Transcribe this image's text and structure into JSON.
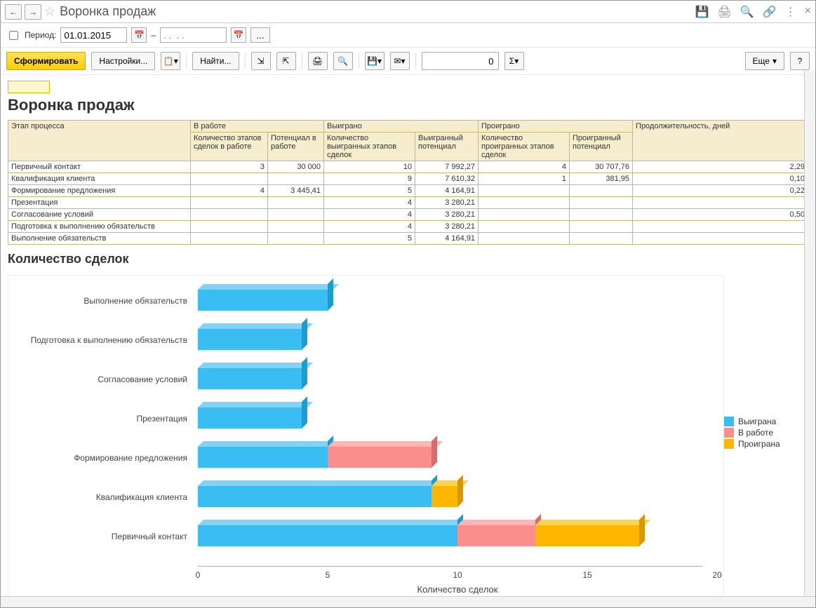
{
  "header": {
    "title": "Воронка продаж",
    "star_icon": "star-outline",
    "nav_back": "←",
    "nav_fwd": "→",
    "icons": {
      "save": "💾",
      "print": "🖨",
      "search": "🔍",
      "link": "🔗",
      "more": "⋮",
      "close": "×"
    }
  },
  "period": {
    "label": "Период:",
    "from": "01.01.2015",
    "to_placeholder": ". .  . .",
    "dash": "–"
  },
  "toolbar": {
    "run": "Сформировать",
    "settings": "Настройки...",
    "find": "Найти...",
    "num_value": "0",
    "more": "Еще",
    "help": "?"
  },
  "report": {
    "title": "Воронка продаж",
    "chart_title": "Количество сделок"
  },
  "table": {
    "headers": {
      "stage": "Этап процесса",
      "group_work": "В работе",
      "group_won": "Выиграно",
      "group_lost": "Проиграно",
      "duration": "Продолжительность, дней",
      "work_count": "Количество этапов сделок в работе",
      "work_pot": "Потенциал в работе",
      "won_count": "Количество выигранных этапов сделок",
      "won_pot": "Выигранный потенциал",
      "lost_count": "Количество проигранных этапов сделок",
      "lost_pot": "Проигранный потенциал"
    },
    "rows": [
      {
        "stage": "Первичный контакт",
        "wc": "3",
        "wp": "30 000",
        "vc": "10",
        "vp": "7 992,27",
        "lc": "4",
        "lp": "30 707,76",
        "d": "2,29"
      },
      {
        "stage": "Квалификация клиента",
        "wc": "",
        "wp": "",
        "vc": "9",
        "vp": "7 610,32",
        "lc": "1",
        "lp": "381,95",
        "d": "0,10"
      },
      {
        "stage": "Формирование предложения",
        "wc": "4",
        "wp": "3 445,41",
        "vc": "5",
        "vp": "4 164,91",
        "lc": "",
        "lp": "",
        "d": "0,22"
      },
      {
        "stage": "Презентация",
        "wc": "",
        "wp": "",
        "vc": "4",
        "vp": "3 280,21",
        "lc": "",
        "lp": "",
        "d": ""
      },
      {
        "stage": "Согласование условий",
        "wc": "",
        "wp": "",
        "vc": "4",
        "vp": "3 280,21",
        "lc": "",
        "lp": "",
        "d": "0,50"
      },
      {
        "stage": "Подготовка к выполнению обязательств",
        "wc": "",
        "wp": "",
        "vc": "4",
        "vp": "3 280,21",
        "lc": "",
        "lp": "",
        "d": ""
      },
      {
        "stage": "Выполнение обязательств",
        "wc": "",
        "wp": "",
        "vc": "5",
        "vp": "4 164,91",
        "lc": "",
        "lp": "",
        "d": ""
      }
    ]
  },
  "chart_data": {
    "type": "bar",
    "orientation": "horizontal-stacked",
    "title": "Количество сделок",
    "xlabel": "Количество сделок",
    "xlim": [
      0,
      20
    ],
    "xticks": [
      0,
      5,
      10,
      15,
      20
    ],
    "legend": [
      {
        "name": "Выиграна",
        "color": "#39bdf3"
      },
      {
        "name": "В работе",
        "color": "#fc8d8d"
      },
      {
        "name": "Проиграна",
        "color": "#ffb600"
      }
    ],
    "categories": [
      "Выполнение обязательств",
      "Подготовка к выполнению обязательств",
      "Согласование условий",
      "Презентация",
      "Формирование предложения",
      "Квалификация клиента",
      "Первичный контакт"
    ],
    "series": [
      {
        "name": "Выиграна",
        "values": [
          5,
          4,
          4,
          4,
          5,
          9,
          10
        ]
      },
      {
        "name": "В работе",
        "values": [
          0,
          0,
          0,
          0,
          4,
          0,
          3
        ]
      },
      {
        "name": "Проиграна",
        "values": [
          0,
          0,
          0,
          0,
          0,
          1,
          4
        ]
      }
    ]
  }
}
